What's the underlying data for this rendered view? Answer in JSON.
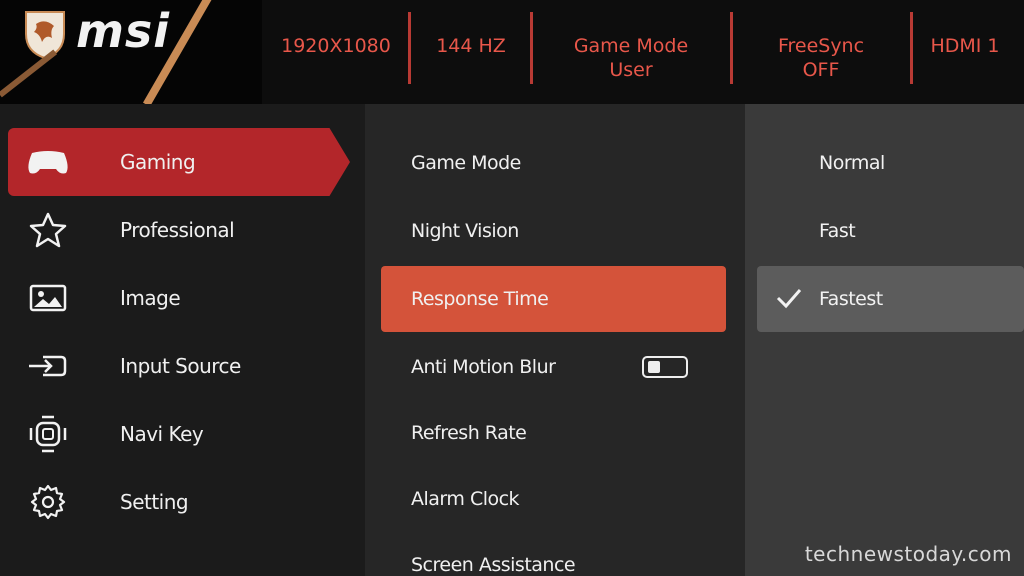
{
  "brand": {
    "logo_text": "msi"
  },
  "status_bar": {
    "resolution": "1920X1080",
    "refresh": "144 HZ",
    "game_mode_line1": "Game Mode",
    "game_mode_line2": "User",
    "freesync_line1": "FreeSync",
    "freesync_line2": "OFF",
    "input": "HDMI 1"
  },
  "categories": [
    {
      "label": "Gaming",
      "icon": "gamepad-icon",
      "active": true
    },
    {
      "label": "Professional",
      "icon": "star-icon",
      "active": false
    },
    {
      "label": "Image",
      "icon": "image-icon",
      "active": false
    },
    {
      "label": "Input Source",
      "icon": "input-source-icon",
      "active": false
    },
    {
      "label": "Navi Key",
      "icon": "navi-key-icon",
      "active": false
    },
    {
      "label": "Setting",
      "icon": "gear-icon",
      "active": false
    }
  ],
  "options": [
    {
      "label": "Game Mode"
    },
    {
      "label": "Night Vision"
    },
    {
      "label": "Response Time",
      "active": true
    },
    {
      "label": "Anti Motion Blur",
      "toggle": "off"
    },
    {
      "label": "Refresh Rate"
    },
    {
      "label": "Alarm Clock"
    },
    {
      "label": "Screen Assistance"
    }
  ],
  "values": [
    {
      "label": "Normal"
    },
    {
      "label": "Fast"
    },
    {
      "label": "Fastest",
      "selected": true
    }
  ],
  "watermark": "technewstoday.com",
  "colors": {
    "accent_red": "#b3262a",
    "highlight_orange": "#d4533a",
    "status_red": "#e8574a"
  }
}
